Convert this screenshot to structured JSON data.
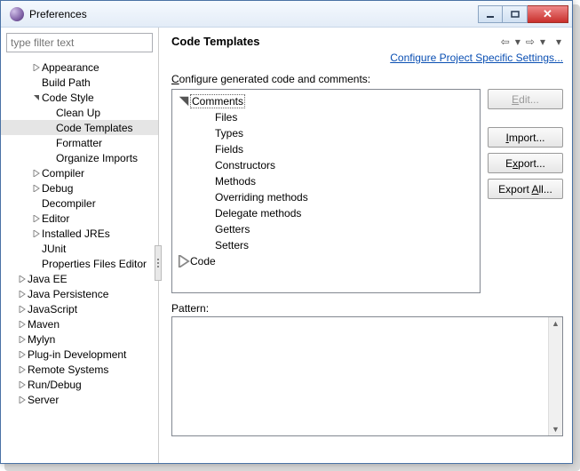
{
  "window": {
    "title": "Preferences"
  },
  "filter": {
    "placeholder": "type filter text"
  },
  "sidebar": [
    {
      "level": 1,
      "exp": "closed",
      "label": "Appearance"
    },
    {
      "level": 1,
      "exp": "none",
      "label": "Build Path"
    },
    {
      "level": 1,
      "exp": "open",
      "label": "Code Style"
    },
    {
      "level": 2,
      "exp": "none",
      "label": "Clean Up"
    },
    {
      "level": 2,
      "exp": "none",
      "label": "Code Templates",
      "sel": true
    },
    {
      "level": 2,
      "exp": "none",
      "label": "Formatter"
    },
    {
      "level": 2,
      "exp": "none",
      "label": "Organize Imports"
    },
    {
      "level": 1,
      "exp": "closed",
      "label": "Compiler"
    },
    {
      "level": 1,
      "exp": "closed",
      "label": "Debug"
    },
    {
      "level": 1,
      "exp": "none",
      "label": "Decompiler"
    },
    {
      "level": 1,
      "exp": "closed",
      "label": "Editor"
    },
    {
      "level": 1,
      "exp": "closed",
      "label": "Installed JREs"
    },
    {
      "level": 1,
      "exp": "none",
      "label": "JUnit"
    },
    {
      "level": 1,
      "exp": "none",
      "label": "Properties Files Editor"
    },
    {
      "level": 0,
      "exp": "closed",
      "label": "Java EE"
    },
    {
      "level": 0,
      "exp": "closed",
      "label": "Java Persistence"
    },
    {
      "level": 0,
      "exp": "closed",
      "label": "JavaScript"
    },
    {
      "level": 0,
      "exp": "closed",
      "label": "Maven"
    },
    {
      "level": 0,
      "exp": "closed",
      "label": "Mylyn"
    },
    {
      "level": 0,
      "exp": "closed",
      "label": "Plug-in Development"
    },
    {
      "level": 0,
      "exp": "closed",
      "label": "Remote Systems"
    },
    {
      "level": 0,
      "exp": "closed",
      "label": "Run/Debug"
    },
    {
      "level": 0,
      "exp": "closed",
      "label": "Server"
    }
  ],
  "main": {
    "title": "Code Templates",
    "link": "Configure Project Specific Settings...",
    "configure_prefix": "C",
    "configure_rest": "onfigure generated code and comments:",
    "pattern_prefix": "P",
    "pattern_rest": "attern:"
  },
  "templates": [
    {
      "level": 0,
      "exp": "open",
      "label": "Comments",
      "sel": true
    },
    {
      "level": 1,
      "exp": "none",
      "label": "Files"
    },
    {
      "level": 1,
      "exp": "none",
      "label": "Types"
    },
    {
      "level": 1,
      "exp": "none",
      "label": "Fields"
    },
    {
      "level": 1,
      "exp": "none",
      "label": "Constructors"
    },
    {
      "level": 1,
      "exp": "none",
      "label": "Methods"
    },
    {
      "level": 1,
      "exp": "none",
      "label": "Overriding methods"
    },
    {
      "level": 1,
      "exp": "none",
      "label": "Delegate methods"
    },
    {
      "level": 1,
      "exp": "none",
      "label": "Getters"
    },
    {
      "level": 1,
      "exp": "none",
      "label": "Setters"
    },
    {
      "level": 0,
      "exp": "closed",
      "label": "Code"
    }
  ],
  "buttons": {
    "edit_u": "E",
    "edit_rest": "dit...",
    "imp_u": "I",
    "imp_rest": "mport...",
    "exp_pre": "E",
    "exp_u": "x",
    "exp_rest": "port...",
    "expall_pre": "Export ",
    "expall_u": "A",
    "expall_rest": "ll..."
  }
}
